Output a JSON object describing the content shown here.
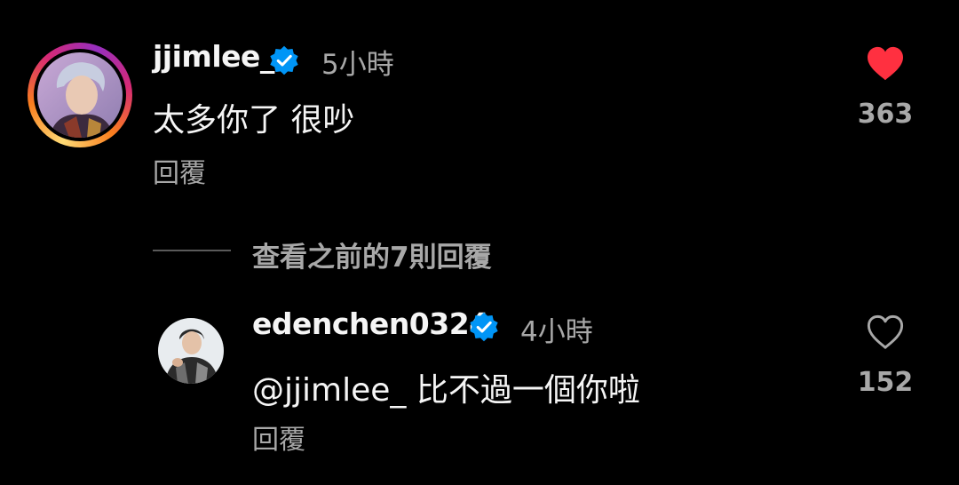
{
  "comment": {
    "username": "jjimlee_",
    "verified": true,
    "timestamp": "5小時",
    "text": "太多你了 很吵",
    "reply_label": "回覆",
    "like_count": "363",
    "liked": true,
    "like_color": "#ff3040"
  },
  "view_replies": {
    "label": "查看之前的7則回覆"
  },
  "reply": {
    "username": "edenchen0324",
    "verified": true,
    "timestamp": "4小時",
    "text": "@jjimlee_ 比不過一個你啦",
    "reply_label": "回覆",
    "like_count": "152",
    "liked": false
  },
  "colors": {
    "background": "#000000",
    "verified_badge": "#0095f6",
    "secondary_text": "#a8a8a8"
  }
}
